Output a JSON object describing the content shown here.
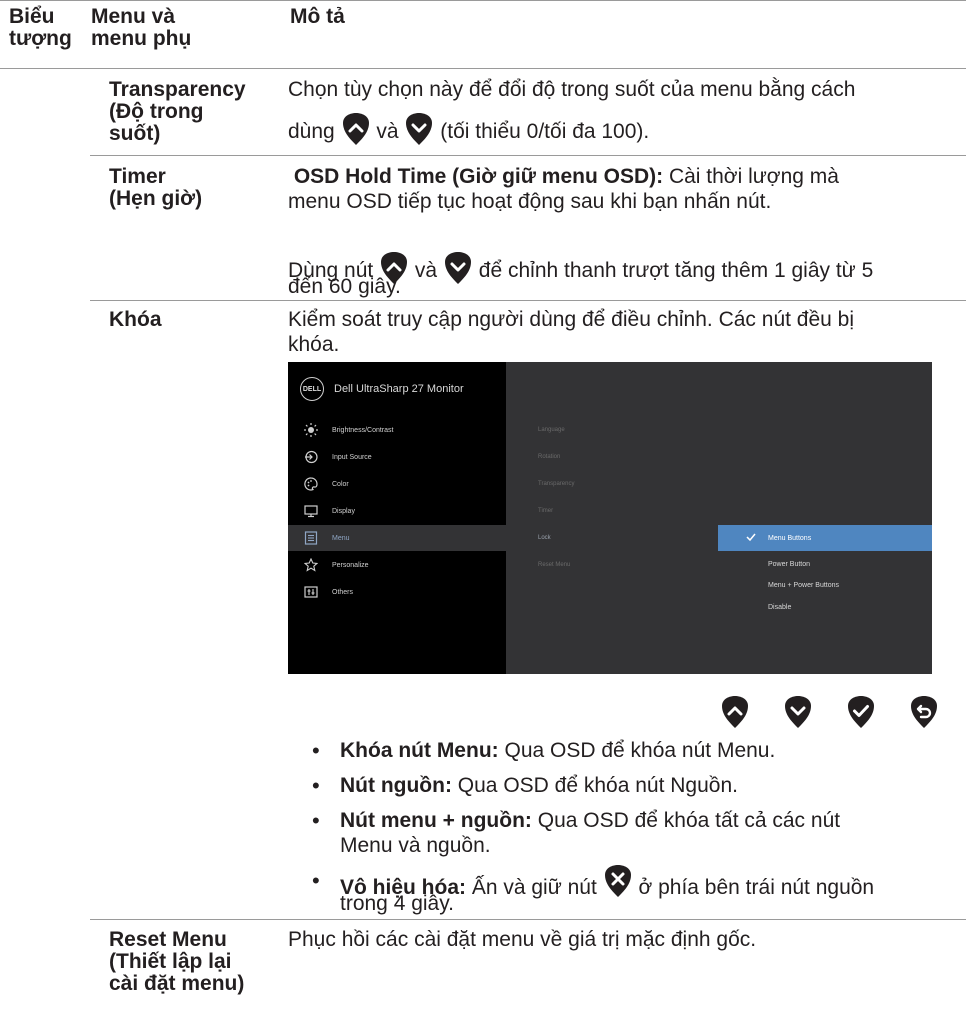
{
  "table_header": {
    "col_icon": [
      "Biểu",
      "tượng"
    ],
    "col_menu": [
      "Menu và",
      "menu phụ"
    ],
    "col_desc": "Mô tả"
  },
  "rows": {
    "transparency": {
      "label": [
        "Transparency",
        "(Độ trong",
        "suốt)"
      ],
      "line1": "Chọn tùy chọn này để đổi độ trong suốt của menu bằng cách",
      "pre": "dùng",
      "mid": "và",
      "post": "(tối thiểu 0/tối đa 100)."
    },
    "timer": {
      "label": [
        "Timer",
        "(Hẹn giờ)"
      ],
      "bold": "OSD Hold Time (Giờ giữ menu OSD):",
      "line1_rest": "Cài thời lượng mà",
      "line2": "menu OSD tiếp tục hoạt động sau khi bạn nhấn nút.",
      "p2_pre": "Dùng nút",
      "p2_mid": "và",
      "p2_post": "để chỉnh thanh trượt tăng thêm 1 giây từ 5",
      "p2_line2": "đến 60 giây."
    },
    "lock": {
      "label": "Khóa",
      "line1": "Kiểm soát truy cập người dùng để điều chỉnh. Các nút đều bị",
      "line2": "khóa."
    },
    "reset": {
      "label": [
        "Reset Menu",
        "(Thiết lập lại",
        "cài đặt menu)"
      ],
      "desc": "Phục hồi các cài đặt menu về giá trị mặc định gốc."
    }
  },
  "osd": {
    "title": "Dell UltraSharp 27 Monitor",
    "logo": "DELL",
    "menu_items": [
      {
        "label": "Brightness/Contrast",
        "icon": "brightness-icon"
      },
      {
        "label": "Input Source",
        "icon": "input-source-icon"
      },
      {
        "label": "Color",
        "icon": "color-palette-icon"
      },
      {
        "label": "Display",
        "icon": "display-icon"
      },
      {
        "label": "Menu",
        "icon": "menu-icon"
      },
      {
        "label": "Personalize",
        "icon": "star-icon"
      },
      {
        "label": "Others",
        "icon": "others-icon"
      }
    ],
    "submenu": [
      "Language",
      "Rotation",
      "Transparency",
      "Timer",
      "Lock",
      "Reset Menu"
    ],
    "options": [
      "Menu Buttons",
      "Power Button",
      "Menu + Power Buttons",
      "Disable"
    ],
    "selected_option": "Menu Buttons",
    "accent": "#4f86c0"
  },
  "bullets": [
    {
      "bold": "Khóa nút Menu:",
      "text": "Qua OSD để khóa nút Menu."
    },
    {
      "bold": "Nút nguồn:",
      "text": "Qua OSD để khóa nút Nguồn."
    },
    {
      "bold": "Nút menu + nguồn:",
      "text": "Qua OSD để khóa tất cả các nút",
      "line2": "Menu và nguồn."
    },
    {
      "bold": "Vô hiệu hóa:",
      "text_pre": "Ấn và giữ nút",
      "text_post": "ở phía bên trái nút nguồn",
      "line2": "trong 4 giây."
    }
  ],
  "bullet_char": "•"
}
